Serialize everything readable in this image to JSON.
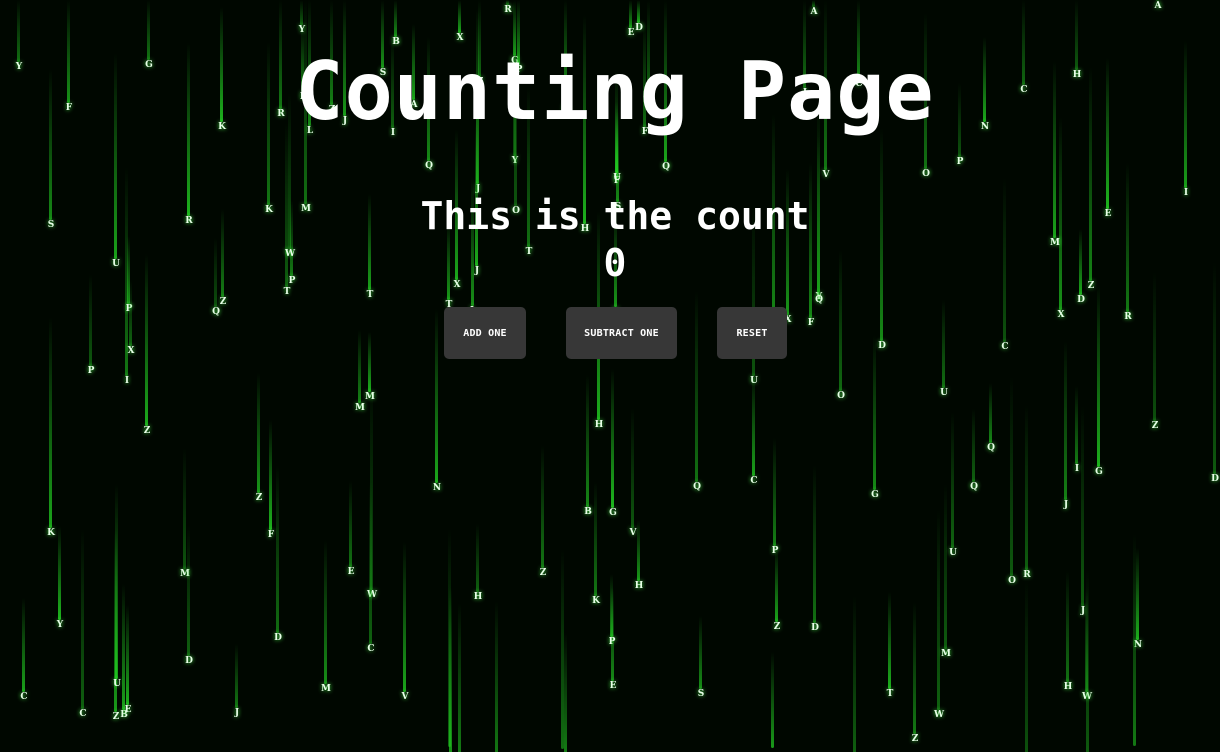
{
  "page": {
    "title": "Counting Page",
    "count_label": "This is the count",
    "count_value": "0"
  },
  "buttons": {
    "add": "ADD ONE",
    "subtract": "SUBTRACT ONE",
    "reset": "RESET"
  },
  "colors": {
    "background": "#000700",
    "rain": "#23d623",
    "rain_head": "#e8ffe8",
    "button": "#373737",
    "text": "#ffffff"
  }
}
